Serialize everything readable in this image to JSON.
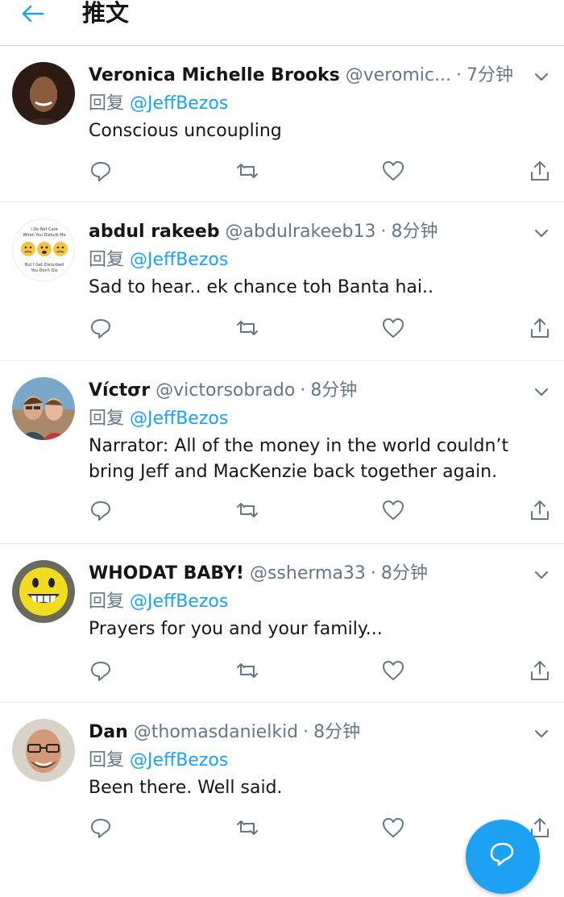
{
  "header": {
    "title": "推文"
  },
  "icons": {
    "back": "back-arrow-icon",
    "more": "chevron-down-icon",
    "reply": "reply-icon",
    "retweet": "retweet-icon",
    "like": "heart-icon",
    "share": "share-icon",
    "fab": "compose-icon"
  },
  "colors": {
    "accent": "#1da1f2",
    "secondary_text": "#657786",
    "primary_text": "#14171a"
  },
  "tweets": [
    {
      "name": "Veronica Michelle Brooks",
      "handle": "@veromic...",
      "time": "7分钟",
      "reply_prefix": "回复",
      "reply_to": "@JeffBezos",
      "text_lines": [
        "Conscious uncoupling"
      ]
    },
    {
      "name": "abdul rakeeb",
      "handle": "@abdulrakeeb13",
      "time": "8分钟",
      "reply_prefix": "回复",
      "reply_to": "@JeffBezos",
      "text_lines": [
        "Sad to hear.. ek chance toh Banta hai.."
      ],
      "avatar_text": [
        "I Do Not Care",
        "When You Disturb Me",
        "But I Get Disturbed",
        "You Don't Dis"
      ]
    },
    {
      "name": "Víctσr",
      "handle": "@victorsobrado",
      "time": "8分钟",
      "reply_prefix": "回复",
      "reply_to": "@JeffBezos",
      "text_lines": [
        "Narrator: All of the money in the world couldn’t",
        "bring Jeff and MacKenzie back together again."
      ]
    },
    {
      "name": "WHODAT BABY!",
      "handle": "@ssherma33",
      "time": "8分钟",
      "reply_prefix": "回复",
      "reply_to": "@JeffBezos",
      "text_lines": [
        "Prayers for you and your family..."
      ]
    },
    {
      "name": "Dan",
      "handle": "@thomasdanielkid",
      "time": "8分钟",
      "reply_prefix": "回复",
      "reply_to": "@JeffBezos",
      "text_lines": [
        "Been there.  Well said."
      ]
    }
  ]
}
